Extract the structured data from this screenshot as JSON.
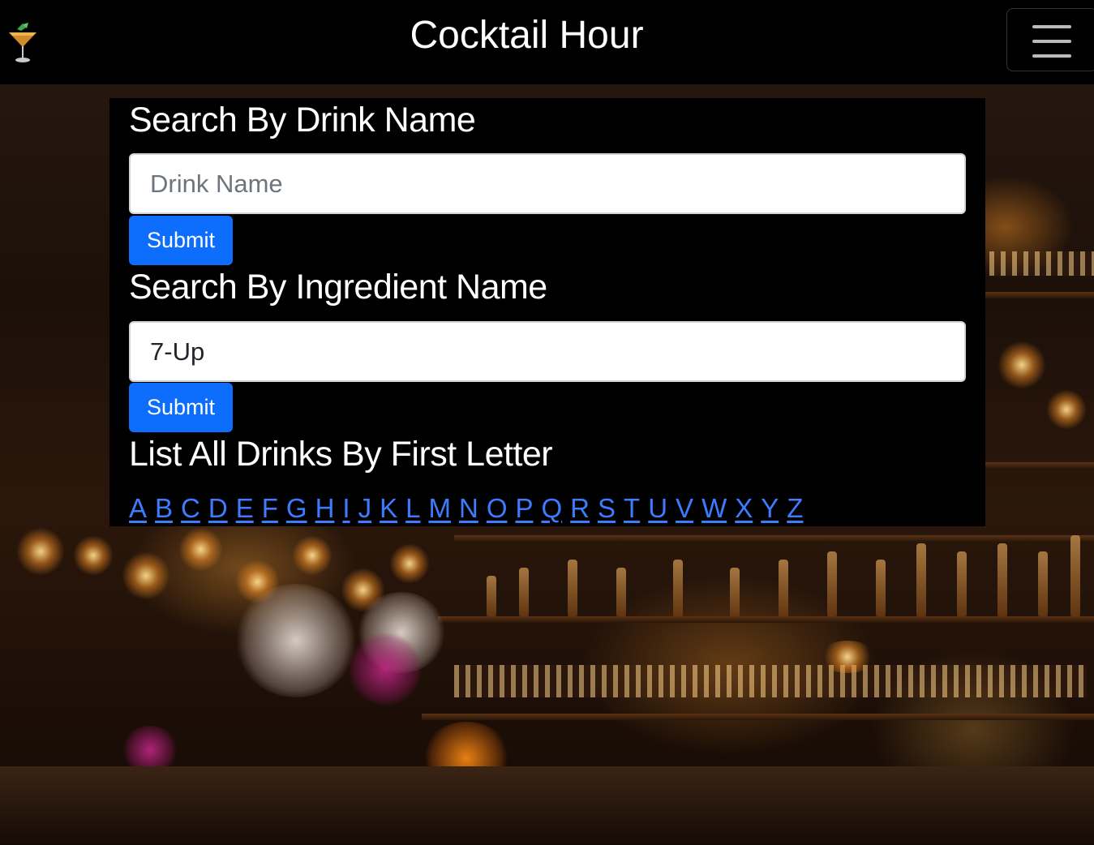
{
  "navbar": {
    "title": "Cocktail Hour",
    "logo_icon": "cocktail-glass-icon",
    "menu_icon": "hamburger-menu-icon"
  },
  "drink_search": {
    "heading": "Search By Drink Name",
    "input_value": "",
    "placeholder": "Drink Name",
    "submit_label": "Submit"
  },
  "ingredient_search": {
    "heading": "Search By Ingredient Name",
    "input_value": "7-Up",
    "placeholder": "",
    "submit_label": "Submit"
  },
  "letter_list": {
    "heading": "List All Drinks By First Letter",
    "letters": [
      "A",
      "B",
      "C",
      "D",
      "E",
      "F",
      "G",
      "H",
      "I",
      "J",
      "K",
      "L",
      "M",
      "N",
      "O",
      "P",
      "Q",
      "R",
      "S",
      "T",
      "U",
      "V",
      "W",
      "X",
      "Y",
      "Z"
    ]
  },
  "colors": {
    "primary": "#0d6efd",
    "link": "#3d7bff",
    "panel": "#000000",
    "navbar": "#000000"
  }
}
